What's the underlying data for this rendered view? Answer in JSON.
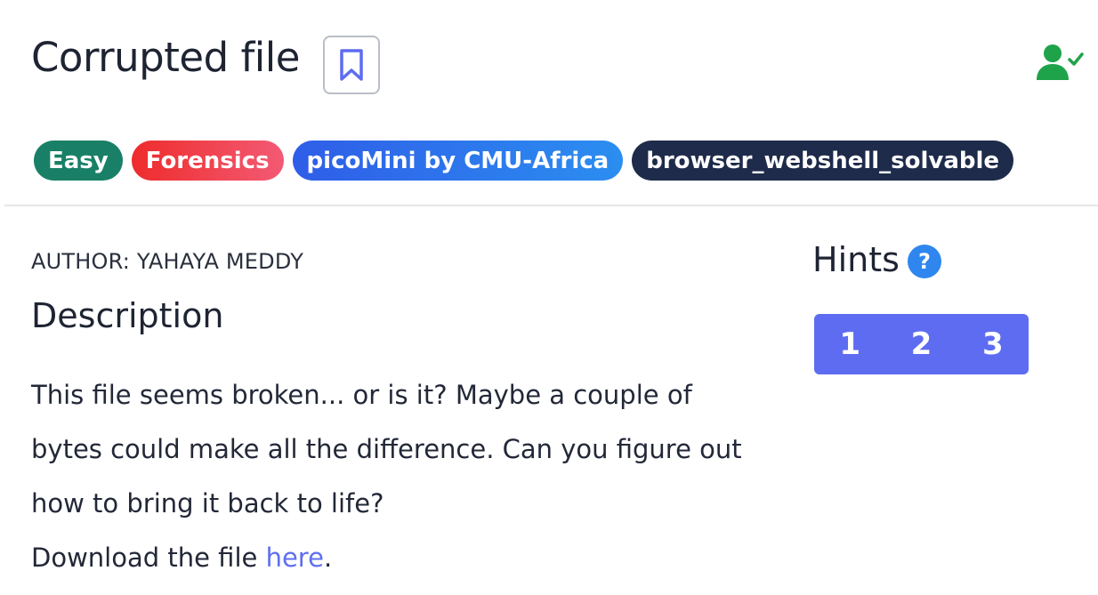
{
  "challenge": {
    "title": "Corrupted file",
    "tags": [
      {
        "label": "Easy",
        "color": "#198067"
      },
      {
        "label": "Forensics",
        "color": "#ee2c2c"
      },
      {
        "label": "picoMini by CMU-Africa",
        "color": "#2f5de8"
      },
      {
        "label": "browser_webshell_solvable",
        "color": "#1e2b4a"
      }
    ],
    "author": "AUTHOR: YAHAYA MEDDY",
    "description_heading": "Description",
    "description": "This file seems broken... or is it? Maybe a couple of bytes could make all the difference. Can you figure out how to bring it back to life?",
    "download_prefix": "Download the file ",
    "download_link": "here",
    "download_suffix": "."
  },
  "hints": {
    "title": "Hints",
    "help_glyph": "?",
    "buttons": [
      "1",
      "2",
      "3"
    ]
  },
  "icons": {
    "bookmark": "bookmark-icon",
    "solved": "user-check-icon"
  },
  "colors": {
    "accent": "#5e6cf1",
    "solved_green": "#1fa34a",
    "link": "#5e6ff0"
  }
}
